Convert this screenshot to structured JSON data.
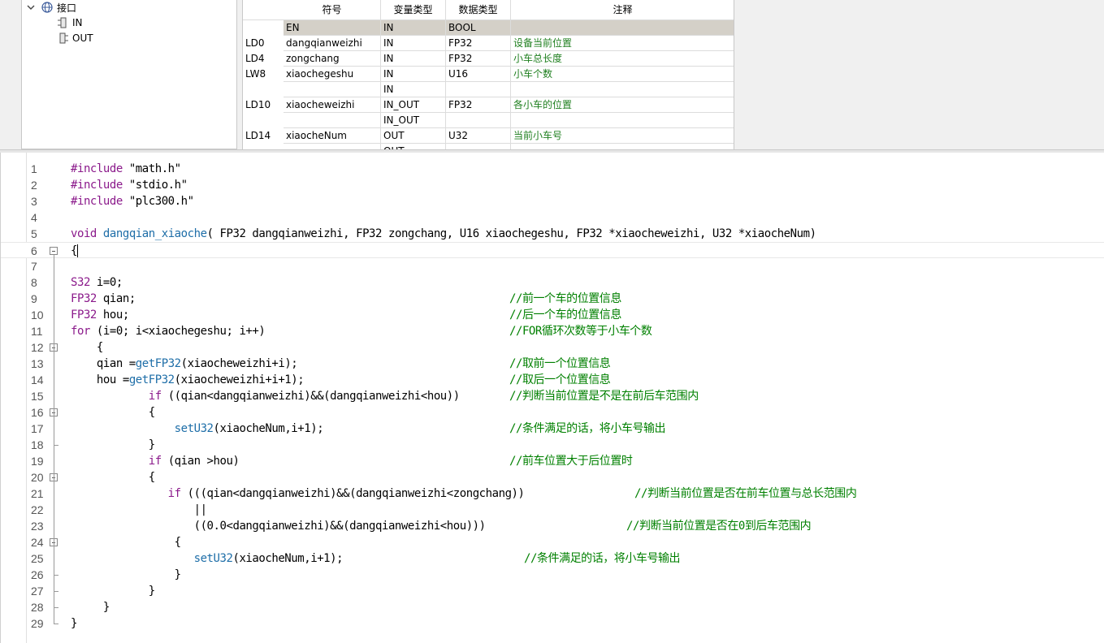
{
  "tree": {
    "root_label": "接口",
    "children": [
      "IN",
      "OUT"
    ]
  },
  "var_table": {
    "headers": [
      "符号",
      "变量类型",
      "数据类型",
      "注释"
    ],
    "rows": [
      {
        "addr": "",
        "symbol": "EN",
        "var_type": "IN",
        "data_type": "BOOL",
        "comment": "",
        "selected": true
      },
      {
        "addr": "LD0",
        "symbol": "dangqianweizhi",
        "var_type": "IN",
        "data_type": "FP32",
        "comment": "设备当前位置"
      },
      {
        "addr": "LD4",
        "symbol": "zongchang",
        "var_type": "IN",
        "data_type": "FP32",
        "comment": "小车总长度"
      },
      {
        "addr": "LW8",
        "symbol": "xiaochegeshu",
        "var_type": "IN",
        "data_type": "U16",
        "comment": "小车个数"
      },
      {
        "addr": "",
        "symbol": "",
        "var_type": "IN",
        "data_type": "",
        "comment": ""
      },
      {
        "addr": "LD10",
        "symbol": "xiaocheweizhi",
        "var_type": "IN_OUT",
        "data_type": "FP32",
        "comment": "各小车的位置"
      },
      {
        "addr": "",
        "symbol": "",
        "var_type": "IN_OUT",
        "data_type": "",
        "comment": ""
      },
      {
        "addr": "LD14",
        "symbol": "xiaocheNum",
        "var_type": "OUT",
        "data_type": "U32",
        "comment": "当前小车号"
      },
      {
        "addr": "",
        "symbol": "",
        "var_type": "OUT",
        "data_type": "",
        "comment": ""
      }
    ]
  },
  "code": {
    "lines": [
      {
        "n": "1",
        "segs": [
          [
            "kw",
            "#include "
          ],
          [
            "st",
            "\"math.h\""
          ]
        ]
      },
      {
        "n": "2",
        "segs": [
          [
            "kw",
            "#include "
          ],
          [
            "st",
            "\"stdio.h\""
          ]
        ]
      },
      {
        "n": "3",
        "segs": [
          [
            "kw",
            "#include "
          ],
          [
            "st",
            "\"plc300.h\""
          ]
        ]
      },
      {
        "n": "4",
        "segs": []
      },
      {
        "n": "5",
        "segs": [
          [
            "kw",
            "void "
          ],
          [
            "fn",
            "dangqian_xiaoche"
          ],
          [
            "st",
            "( FP32 dangqianweizhi, FP32 zongchang, U16 xiaochegeshu, FP32 *xiaocheweizhi, U32 *xiaocheNum)"
          ]
        ]
      },
      {
        "n": "6",
        "segs": [
          [
            "st",
            "{"
          ]
        ],
        "caret": true
      },
      {
        "n": "7",
        "segs": []
      },
      {
        "n": "8",
        "segs": [
          [
            "kw",
            "S32 "
          ],
          [
            "st",
            "i=0;"
          ]
        ]
      },
      {
        "n": "9",
        "segs": [
          [
            "kw",
            "FP32 "
          ],
          [
            "st",
            "qian;"
          ]
        ],
        "comment": "//前一个车的位置信息"
      },
      {
        "n": "10",
        "segs": [
          [
            "kw",
            "FP32 "
          ],
          [
            "st",
            "hou;"
          ]
        ],
        "comment": "//后一个车的位置信息"
      },
      {
        "n": "11",
        "segs": [
          [
            "kw",
            "for "
          ],
          [
            "st",
            "(i=0; i<xiaochegeshu; i++)"
          ]
        ],
        "comment": "//FOR循环次数等于小车个数"
      },
      {
        "n": "12",
        "segs": [
          [
            "st",
            "    {"
          ]
        ]
      },
      {
        "n": "13",
        "segs": [
          [
            "st",
            "    qian ="
          ],
          [
            "fn",
            "getFP32"
          ],
          [
            "st",
            "(xiaocheweizhi+i);"
          ]
        ],
        "comment": "//取前一个位置信息"
      },
      {
        "n": "14",
        "segs": [
          [
            "st",
            "    hou ="
          ],
          [
            "fn",
            "getFP32"
          ],
          [
            "st",
            "(xiaocheweizhi+i+1);"
          ]
        ],
        "comment": "//取后一个位置信息"
      },
      {
        "n": "15",
        "segs": [
          [
            "kw",
            "            if "
          ],
          [
            "st",
            "((qian<dangqianweizhi)&&(dangqianweizhi<hou))"
          ]
        ],
        "comment": "//判断当前位置是不是在前后车范围内"
      },
      {
        "n": "16",
        "segs": [
          [
            "st",
            "            {"
          ]
        ]
      },
      {
        "n": "17",
        "segs": [
          [
            "fn",
            "                setU32"
          ],
          [
            "st",
            "(xiaocheNum,i+1);"
          ]
        ],
        "comment": "//条件满足的话，将小车号输出"
      },
      {
        "n": "18",
        "segs": [
          [
            "st",
            "            }"
          ]
        ]
      },
      {
        "n": "19",
        "segs": [
          [
            "kw",
            "            if "
          ],
          [
            "st",
            "(qian >hou)"
          ]
        ],
        "comment": "//前车位置大于后位置时"
      },
      {
        "n": "20",
        "segs": [
          [
            "st",
            "            {"
          ]
        ]
      },
      {
        "n": "21",
        "segs": [
          [
            "kw",
            "               if "
          ],
          [
            "st",
            "(((qian<dangqianweizhi)&&(dangqianweizhi<zongchang))"
          ]
        ],
        "comment": "//判断当前位置是否在前车位置与总长范围内"
      },
      {
        "n": "22",
        "segs": [
          [
            "st",
            "                   ||"
          ]
        ]
      },
      {
        "n": "23",
        "segs": [
          [
            "st",
            "                   ((0.0<dangqianweizhi)&&(dangqianweizhi<hou)))"
          ]
        ],
        "comment": "//判断当前位置是否在0到后车范围内"
      },
      {
        "n": "24",
        "segs": [
          [
            "st",
            "                {"
          ]
        ]
      },
      {
        "n": "25",
        "segs": [
          [
            "fn",
            "                   setU32"
          ],
          [
            "st",
            "(xiaocheNum,i+1);"
          ]
        ],
        "comment": "//条件满足的话，将小车号输出"
      },
      {
        "n": "26",
        "segs": [
          [
            "st",
            "                }"
          ]
        ]
      },
      {
        "n": "27",
        "segs": [
          [
            "st",
            "            }"
          ]
        ]
      },
      {
        "n": "28",
        "segs": [
          [
            "st",
            "     }"
          ]
        ]
      },
      {
        "n": "29",
        "segs": [
          [
            "st",
            "}"
          ]
        ]
      }
    ]
  }
}
